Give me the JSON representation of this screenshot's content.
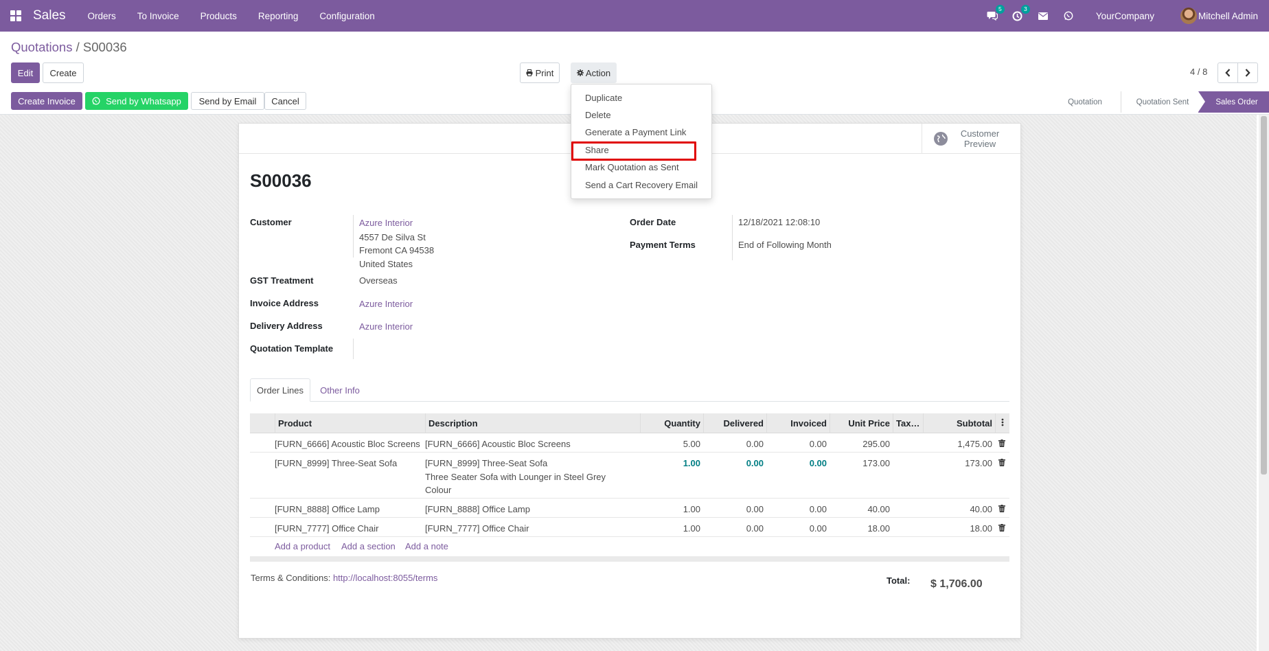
{
  "navbar": {
    "brand": "Sales",
    "menu": [
      "Orders",
      "To Invoice",
      "Products",
      "Reporting",
      "Configuration"
    ],
    "chat_badge": "5",
    "activity_badge": "3",
    "company": "YourCompany",
    "user": "Mitchell Admin"
  },
  "breadcrumb": {
    "parent": "Quotations",
    "separator": "/",
    "current": "S00036"
  },
  "toolbar": {
    "edit": "Edit",
    "create": "Create",
    "print": "Print",
    "action": "Action",
    "pager": "4 / 8"
  },
  "header_buttons": {
    "create_invoice": "Create Invoice",
    "send_whatsapp": "Send by Whatsapp",
    "send_email": "Send by Email",
    "cancel": "Cancel"
  },
  "statusbar": [
    "Quotation",
    "Quotation Sent",
    "Sales Order"
  ],
  "action_menu": [
    "Duplicate",
    "Delete",
    "Generate a Payment Link",
    "Share",
    "Mark Quotation as Sent",
    "Send a Cart Recovery Email"
  ],
  "sheet": {
    "customer_preview": "Customer Preview",
    "title": "S00036",
    "fields": {
      "customer_label": "Customer",
      "customer_name": "Azure Interior",
      "address_line1": "4557 De Silva St",
      "address_line2": "Fremont CA 94538",
      "address_line3": "United States",
      "gst_label": "GST Treatment",
      "gst_value": "Overseas",
      "invoice_label": "Invoice Address",
      "invoice_value": "Azure Interior",
      "delivery_label": "Delivery Address",
      "delivery_value": "Azure Interior",
      "template_label": "Quotation Template",
      "order_date_label": "Order Date",
      "order_date_value": "12/18/2021 12:08:10",
      "payment_terms_label": "Payment Terms",
      "payment_terms_value": "End of Following Month"
    },
    "tabs": [
      "Order Lines",
      "Other Info"
    ],
    "columns": [
      "Product",
      "Description",
      "Quantity",
      "Delivered",
      "Invoiced",
      "Unit Price",
      "Tax…",
      "Subtotal"
    ],
    "lines": [
      {
        "product": "[FURN_6666] Acoustic Bloc Screens",
        "description": [
          "[FURN_6666] Acoustic Bloc Screens"
        ],
        "quantity": "5.00",
        "delivered": "0.00",
        "invoiced": "0.00",
        "unit_price": "295.00",
        "subtotal": "1,475.00",
        "highlight": false
      },
      {
        "product": "[FURN_8999] Three-Seat Sofa",
        "description": [
          "[FURN_8999] Three-Seat Sofa",
          "Three Seater Sofa with Lounger in Steel Grey",
          "Colour"
        ],
        "quantity": "1.00",
        "delivered": "0.00",
        "invoiced": "0.00",
        "unit_price": "173.00",
        "subtotal": "173.00",
        "highlight": true
      },
      {
        "product": "[FURN_8888] Office Lamp",
        "description": [
          "[FURN_8888] Office Lamp"
        ],
        "quantity": "1.00",
        "delivered": "0.00",
        "invoiced": "0.00",
        "unit_price": "40.00",
        "subtotal": "40.00",
        "highlight": false
      },
      {
        "product": "[FURN_7777] Office Chair",
        "description": [
          "[FURN_7777] Office Chair"
        ],
        "quantity": "1.00",
        "delivered": "0.00",
        "invoiced": "0.00",
        "unit_price": "18.00",
        "subtotal": "18.00",
        "highlight": false
      }
    ],
    "add_links": [
      "Add a product",
      "Add a section",
      "Add a note"
    ],
    "terms_label": "Terms & Conditions:",
    "terms_link": "http://localhost:8055/terms",
    "total_label": "Total:",
    "total_value": "$ 1,706.00"
  },
  "colors": {
    "brand": "#7c5b9e",
    "whatsapp": "#25d366",
    "highlight_box": "#e00000",
    "badge": "#00a09d",
    "hl_numbers": "#017e84"
  }
}
